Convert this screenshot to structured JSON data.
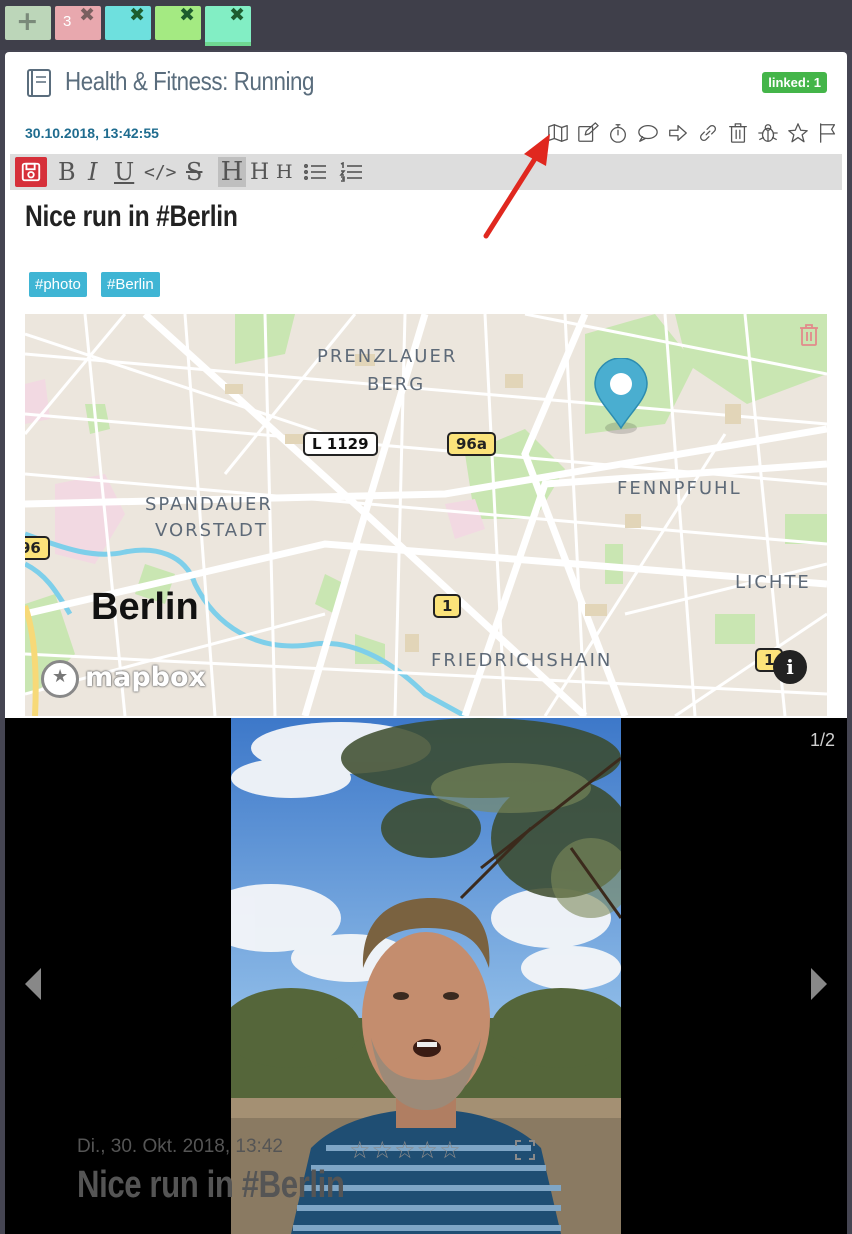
{
  "tabs": [
    {
      "label": "+",
      "kind": "add"
    },
    {
      "label": "3",
      "close": "✖",
      "color": "#e8a8ae"
    },
    {
      "label": "",
      "close": "✖",
      "color": "#6ee0de"
    },
    {
      "label": "",
      "close": "✖",
      "color": "#a4ea82"
    },
    {
      "label": "",
      "close": "✖",
      "color": "#82eec4",
      "active": true
    }
  ],
  "entry": {
    "category_icon": "book-icon",
    "title": "Health & Fitness: Running",
    "linked_badge": "linked: 1",
    "timestamp": "30.10.2018, 13:42:55",
    "actions": [
      "map-icon",
      "edit-icon",
      "stopwatch-icon",
      "comment-icon",
      "share-icon",
      "link-icon",
      "trash-icon",
      "bug-icon",
      "star-icon",
      "flag-icon"
    ],
    "toolbar": {
      "save_icon": "save-icon",
      "bold": "B",
      "italic": "I",
      "underline": "U",
      "code": "</>",
      "strike": "S",
      "h1": "H",
      "h2": "H",
      "h3": "H",
      "ul_icon": "bullet-list-icon",
      "ol_icon": "numbered-list-icon"
    },
    "headline": "Nice run in #Berlin",
    "hashtags": [
      "#photo",
      "#Berlin"
    ]
  },
  "map": {
    "labels": {
      "prenzlauer": "PRENZLAUER",
      "berg": "BERG",
      "spandauer": "SPANDAUER",
      "vorstadt": "VORSTADT",
      "fennpfuhl": "FENNPFUHL",
      "lichte": "LICHTE",
      "friedrichshain": "FRIEDRICHSHAIN",
      "city": "Berlin"
    },
    "shields": {
      "l1129": "L 1129",
      "r96a": "96a",
      "r1": "1",
      "r96": "96",
      "r1b": "1"
    },
    "attribution": "mapbox",
    "info": "i"
  },
  "lightbox": {
    "counter": "1/2",
    "caption_date": "Di., 30. Okt. 2018, 13:42",
    "caption_title": "Nice run in #Berlin",
    "stars": "☆☆☆☆☆"
  },
  "colors": {
    "accent_blue": "#3fb5d4",
    "linked_green": "#44b549",
    "save_red": "#d6303a",
    "timestamp_blue": "#1f6c8f",
    "pin_blue": "#4aaed0",
    "arrow_red": "#e0281f"
  }
}
